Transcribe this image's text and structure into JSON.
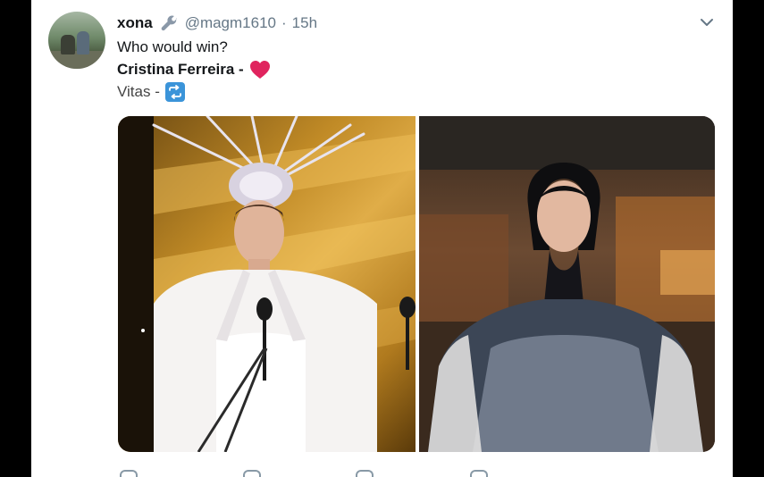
{
  "tweet": {
    "display_name": "xona",
    "handle": "@magm1610",
    "separator": "·",
    "time": "15h",
    "text_line_1": "Who would win?",
    "option_1": "Cristina Ferreira -",
    "option_2": "Vitas -",
    "option_1_emoji": "red-heart",
    "option_2_emoji": "repeat-button"
  },
  "colors": {
    "name": "#14171a",
    "secondary": "#657786",
    "heart": "#e0245e",
    "retweet_blue": "#3b94d9"
  },
  "icons": {
    "name_badge": "wrench-icon",
    "menu": "chevron-down-icon"
  }
}
